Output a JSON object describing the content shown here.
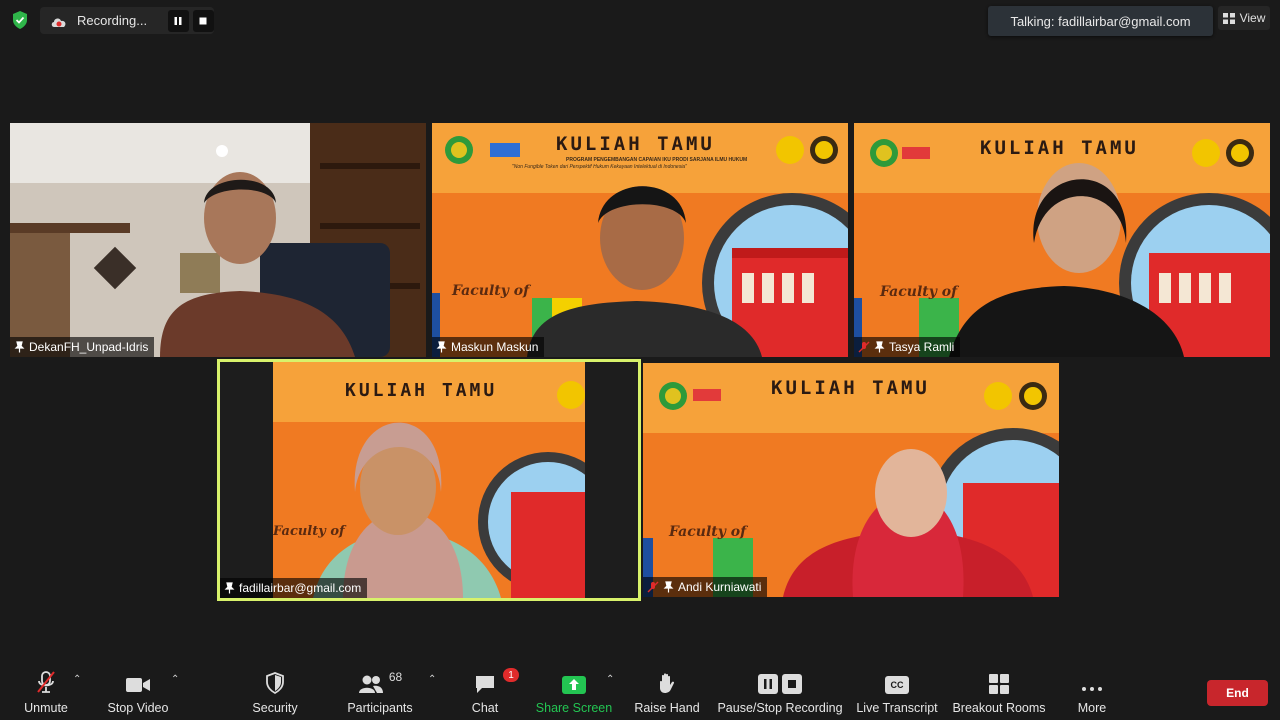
{
  "top_bar": {
    "recording_label": "Recording...",
    "talking_label": "Talking: fadillairbar@gmail.com",
    "view_label": "View"
  },
  "tiles": [
    {
      "name": "DekanFH_Unpad-Idris",
      "muted": false
    },
    {
      "name": "Maskun Maskun",
      "muted": false
    },
    {
      "name": "Tasya Ramli",
      "muted": true
    },
    {
      "name": "fadillairbar@gmail.com",
      "muted": false,
      "active_speaker": true
    },
    {
      "name": "Andi Kurniawati",
      "muted": true
    }
  ],
  "banner": {
    "title": "KULIAH TAMU",
    "subtitle": "PROGRAM PENGEMBANGAN CAPAIAN IKU PRODI SARJANA ILMU HUKUM",
    "quote": "\"Non Fungible Token dari Perspektif Hukum Kekayaan Intelektual di Indonesia\"",
    "faculty": "Faculty of"
  },
  "toolbar": {
    "unmute": "Unmute",
    "stop_video": "Stop Video",
    "security": "Security",
    "participants": "Participants",
    "participants_count": "68",
    "chat": "Chat",
    "chat_badge": "1",
    "share_screen": "Share Screen",
    "raise_hand": "Raise Hand",
    "pause_stop_recording": "Pause/Stop Recording",
    "cc_icon_text": "CC",
    "live_transcript": "Live Transcript",
    "breakout_rooms": "Breakout Rooms",
    "more": "More",
    "end": "End"
  },
  "colors": {
    "background": "#1a1a1a",
    "share_green": "#23c552",
    "end_red": "#c8262c",
    "active_speaker": "#d8f26b",
    "banner_orange": "#f07a22"
  }
}
